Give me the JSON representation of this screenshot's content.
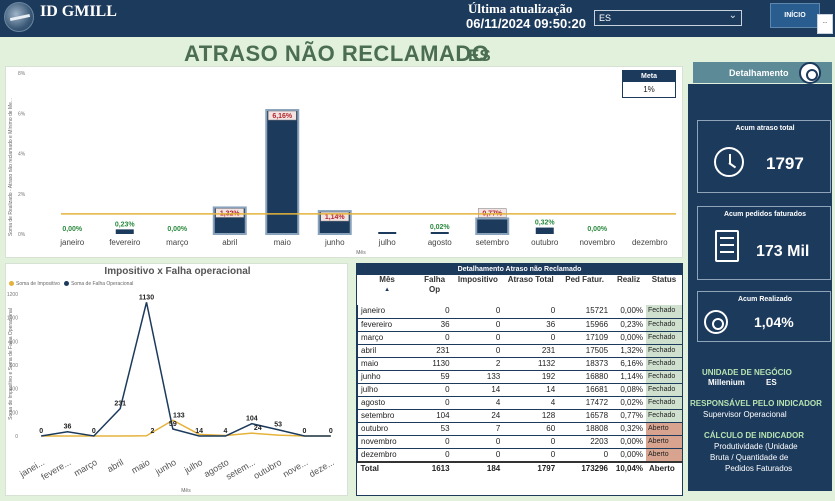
{
  "header": {
    "brand": "ID GMILL",
    "last_update_label": "Última atualização",
    "last_update_value": "06/11/2024 09:50:20",
    "unit_select": "ES",
    "home_button": "INÍCIO",
    "more_glyph": ".."
  },
  "page": {
    "title": "ATRASO NÃO RECLAMADO",
    "subtitle": "ES"
  },
  "meta": {
    "label": "Meta",
    "value": "1%"
  },
  "chart_data": [
    {
      "type": "bar",
      "categories": [
        "janeiro",
        "fevereiro",
        "março",
        "abril",
        "maio",
        "junho",
        "julho",
        "agosto",
        "setembro",
        "outubro",
        "novembro",
        "dezembro"
      ],
      "values": [
        0.0,
        0.23,
        0.0,
        1.32,
        6.16,
        1.14,
        0.08,
        0.02,
        0.77,
        0.32,
        0.0,
        null
      ],
      "labels": [
        "0,00%",
        "0,23%",
        "0,00%",
        "1,32%",
        "6,16%",
        "1,14%",
        "",
        "0,02%",
        "0,77%",
        "0,32%",
        "0,00%",
        ""
      ],
      "ylim": [
        0,
        8
      ],
      "yticks": [
        "0%",
        "2%",
        "4%",
        "6%",
        "8%"
      ],
      "ylabel": "Soma de Realizado - Atraso não reclamado e Mínimo de Me...",
      "xlabel": "Mês",
      "goal": 1,
      "highlight": [
        3,
        4,
        5,
        8
      ]
    },
    {
      "type": "line",
      "title": "Impositivo x Falha operacional",
      "categories": [
        "janei...",
        "fevere...",
        "março",
        "abril",
        "maio",
        "junho",
        "julho",
        "agosto",
        "setem...",
        "outubro",
        "nove...",
        "deze..."
      ],
      "series": [
        {
          "name": "Soma de Impositivo",
          "color": "#e5b33b",
          "values": [
            0,
            0,
            0,
            0,
            2,
            133,
            14,
            4,
            24,
            7,
            0,
            0
          ]
        },
        {
          "name": "Soma de Falha Operacional",
          "color": "#1c3a5c",
          "values": [
            0,
            36,
            0,
            231,
            1130,
            59,
            0,
            0,
            104,
            53,
            0,
            0
          ]
        }
      ],
      "point_labels": [
        "0",
        "36",
        "0",
        "231",
        "1130",
        "59",
        "14",
        "4",
        "104",
        "53",
        "0",
        "0"
      ],
      "point_labels_y": [
        "0",
        "0",
        "0",
        "0",
        "2",
        "133",
        "14",
        "4",
        "24",
        "7",
        "0",
        "0"
      ],
      "ylim": [
        0,
        1200
      ],
      "yticks": [
        "0",
        "200",
        "400",
        "600",
        "800",
        "1000",
        "1200"
      ],
      "ylabel": "Soma de Impositivo e Soma de Falha Operacional",
      "xlabel": "Mês"
    }
  ],
  "table": {
    "title": "Detalhamento Atraso não Reclamado",
    "columns": [
      "Mês",
      "Falha Op",
      "Impositivo",
      "Atraso Total",
      "Ped Fatur.",
      "Realiz",
      "Status"
    ],
    "sort_glyph": "▲",
    "rows": [
      [
        "janeiro",
        "0",
        "0",
        "0",
        "15721",
        "0,00%",
        "Fechado",
        "f"
      ],
      [
        "fevereiro",
        "36",
        "0",
        "36",
        "15966",
        "0,23%",
        "Fechado",
        "f"
      ],
      [
        "março",
        "0",
        "0",
        "0",
        "17109",
        "0,00%",
        "Fechado",
        "f"
      ],
      [
        "abril",
        "231",
        "0",
        "231",
        "17505",
        "1,32%",
        "Fechado",
        "f"
      ],
      [
        "maio",
        "1130",
        "2",
        "1132",
        "18373",
        "6,16%",
        "Fechado",
        "f"
      ],
      [
        "junho",
        "59",
        "133",
        "192",
        "16880",
        "1,14%",
        "Fechado",
        "f"
      ],
      [
        "julho",
        "0",
        "14",
        "14",
        "16681",
        "0,08%",
        "Fechado",
        "f"
      ],
      [
        "agosto",
        "0",
        "4",
        "4",
        "17472",
        "0,02%",
        "Fechado",
        "f"
      ],
      [
        "setembro",
        "104",
        "24",
        "128",
        "16578",
        "0,77%",
        "Fechado",
        "f"
      ],
      [
        "outubro",
        "53",
        "7",
        "60",
        "18808",
        "0,32%",
        "Aberto",
        "a"
      ],
      [
        "novembro",
        "0",
        "0",
        "0",
        "2203",
        "0,00%",
        "Aberto",
        "a"
      ],
      [
        "dezembro",
        "0",
        "0",
        "0",
        "0",
        "0,00%",
        "Aberto",
        "a"
      ]
    ],
    "total": [
      "Total",
      "1613",
      "184",
      "1797",
      "173296",
      "10,04%",
      "Aberto"
    ]
  },
  "panel": {
    "header": "Detalhamento",
    "kpi1_label": "Acum atraso total",
    "kpi1_value": "1797",
    "kpi2_label": "Acum pedidos faturados",
    "kpi2_value": "173 Mil",
    "kpi3_label": "Acum Realizado",
    "kpi3_value": "1,04%",
    "unit_label": "UNIDADE DE NEGÓCIO",
    "unit_name": "Millenium",
    "unit_code": "ES",
    "resp_label": "RESPONSÁVEL PELO INDICADOR",
    "resp_value": "Supervisor Operacional",
    "calc_label": "CÁLCULO DE INDICADOR",
    "calc_value_1": "Produtividade (Unidade",
    "calc_value_2": "Bruta / Quantidade de",
    "calc_value_3": "Pedidos Faturados"
  }
}
